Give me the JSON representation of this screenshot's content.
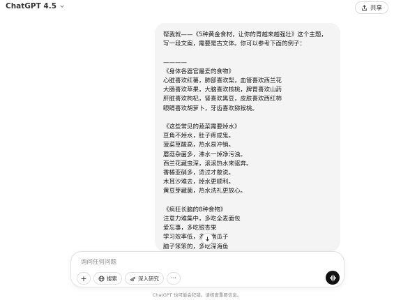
{
  "header": {
    "model_name": "ChatGPT 4.5",
    "share_label": "共享"
  },
  "message": {
    "text": "帮我就——《5种黄金食材，让你的胃越来越强壮》这个主题，写一段文案，需要是古文体。你可以参考下面的例子：\n\n————\n《身体各器官最爱的食物》\n心脏喜欢红薯，肺部喜欢梨，血管喜欢西兰花\n大肠喜欢苹果，大脑喜欢核桃，脾胃喜欢山药\n肝脏喜欢枸杞，肾喜欢黑豆，皮肤喜欢西红柿\n眼睛喜欢胡萝卜，牙齿喜欢猕猴桃。\n\n《这些常见的蔬菜需要焯水》\n豆角不焯水，肚子疼成鬼。\n菠菜草酸高，热水易冲销。\n蘑菇杂菌多，沸水一焯净污浊。\n西兰花藏虫深，滚滚热水来驱奔。\n香椿亚硝多，烫过才敢说。\n木耳沙难去，焯水更顺利。\n黄豆芽藏菌，热水洗礼更放心。\n\n《疯狂长脑的8种食物》\n注意力难集中，多吃全麦面包\n爱忘事，多吃银杏果\n学习效率低，多吃南瓜子\n脑子笨笨的，多吃深海鱼\n记忆力衰退，多吃花生\n大脑紧绷，多喝绿茶\n逻辑混乱，多吃菠菜"
  },
  "composer": {
    "placeholder": "询问任何问题",
    "add_label": "+",
    "search_label": "搜索",
    "deep_research_label": "深入研究",
    "more_label": "···"
  },
  "footer": {
    "disclaimer": "ChatGPT 也可能会犯错。请核查重要信息。"
  },
  "icons": {
    "chevron": "chevron-down-icon",
    "share": "share-icon",
    "globe": "globe-icon",
    "telescope": "telescope-icon",
    "scroll": "arrow-down-icon",
    "voice": "voice-waveform-icon"
  },
  "colors": {
    "bubble": "#f4f4f4",
    "voice_button": "#111111"
  }
}
